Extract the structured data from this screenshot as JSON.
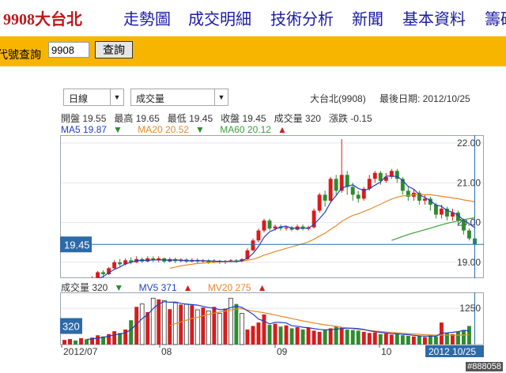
{
  "nav": {
    "stock": "9908大台北",
    "items": [
      "走勢圖",
      "成交明細",
      "技術分析",
      "新聞",
      "基本資料",
      "籌碼"
    ]
  },
  "search": {
    "label": "代號查詢",
    "value": "9908",
    "button": "查詢"
  },
  "controls": {
    "period_select": "日線",
    "indicator_select": "成交量"
  },
  "header": {
    "stock_name": "大台北(9908)",
    "last_date_label": "最後日期: 2012/10/25"
  },
  "quote": {
    "open": "開盤 19.55",
    "high": "最高 19.65",
    "low": "最低 19.45",
    "close": "收盤 19.45",
    "volume": "成交量 320",
    "change": "漲跌 -0.15"
  },
  "ma": {
    "ma5": "MA5 19.87",
    "ma20": "MA20 20.52",
    "ma60": "MA60 20.12"
  },
  "vol_ma": {
    "vol": "成交量 320",
    "mv5": "MV5 371",
    "mv20": "MV20 275"
  },
  "colors": {
    "up": "#d71c1c",
    "down": "#2e8b2e",
    "ma5": "#1f3fbf",
    "ma20": "#e8892a",
    "ma60": "#3aa03a",
    "nav_link": "#1a1aa6",
    "accent": "#f7b500"
  },
  "chart_data": {
    "type": "candlestick",
    "price_axis_ticks": [
      "22.00",
      "21.00",
      "20.00",
      "19.00"
    ],
    "price_ylim": [
      18.6,
      22.2
    ],
    "current_price_label": "19.45",
    "volume_axis_ticks": [
      "1250"
    ],
    "current_volume_label": "320",
    "x_ticks": [
      "2012/07",
      "08",
      "09",
      "10"
    ],
    "last_date_label": "2012 10/25",
    "candles": [
      [
        18.2,
        18.4,
        18.18,
        18.42
      ],
      [
        18.4,
        18.45,
        18.35,
        18.5
      ],
      [
        18.42,
        18.38,
        18.32,
        18.48
      ],
      [
        18.38,
        18.55,
        18.35,
        18.58
      ],
      [
        18.55,
        18.52,
        18.45,
        18.6
      ],
      [
        18.52,
        18.6,
        18.48,
        18.65
      ],
      [
        18.6,
        18.75,
        18.58,
        18.78
      ],
      [
        18.75,
        18.7,
        18.62,
        18.8
      ],
      [
        18.7,
        18.85,
        18.68,
        18.88
      ],
      [
        18.85,
        19.0,
        18.82,
        19.05
      ],
      [
        19.0,
        18.95,
        18.9,
        19.08
      ],
      [
        18.95,
        19.05,
        18.92,
        19.1
      ],
      [
        19.05,
        19.0,
        18.95,
        19.12
      ],
      [
        19.0,
        19.08,
        18.98,
        19.15
      ],
      [
        19.08,
        19.02,
        18.98,
        19.12
      ],
      [
        19.02,
        19.1,
        19.0,
        19.15
      ],
      [
        19.1,
        19.05,
        19.0,
        19.15
      ],
      [
        19.05,
        19.1,
        19.0,
        19.15
      ],
      [
        19.1,
        19.02,
        18.98,
        19.12
      ],
      [
        19.02,
        19.08,
        19.0,
        19.12
      ],
      [
        19.08,
        19.03,
        18.98,
        19.12
      ],
      [
        19.03,
        19.07,
        19.0,
        19.1
      ],
      [
        19.07,
        19.02,
        18.98,
        19.1
      ],
      [
        19.02,
        19.06,
        19.0,
        19.1
      ],
      [
        19.06,
        19.02,
        18.98,
        19.1
      ],
      [
        19.02,
        19.05,
        18.98,
        19.08
      ],
      [
        19.05,
        19.0,
        18.96,
        19.08
      ],
      [
        19.0,
        19.04,
        18.98,
        19.08
      ],
      [
        19.04,
        19.0,
        18.96,
        19.06
      ],
      [
        19.0,
        19.03,
        18.96,
        19.06
      ],
      [
        19.03,
        19.05,
        19.0,
        19.08
      ],
      [
        19.05,
        19.02,
        18.98,
        19.08
      ],
      [
        19.02,
        19.08,
        19.0,
        19.1
      ],
      [
        19.08,
        19.3,
        19.05,
        19.35
      ],
      [
        19.3,
        19.55,
        19.28,
        19.6
      ],
      [
        19.55,
        19.8,
        19.5,
        19.85
      ],
      [
        19.8,
        20.05,
        19.75,
        20.1
      ],
      [
        20.05,
        19.85,
        19.8,
        20.1
      ],
      [
        19.85,
        19.9,
        19.8,
        19.95
      ],
      [
        19.9,
        19.85,
        19.8,
        19.95
      ],
      [
        19.85,
        19.88,
        19.8,
        19.92
      ],
      [
        19.88,
        19.82,
        19.78,
        19.92
      ],
      [
        19.82,
        19.9,
        19.8,
        19.95
      ],
      [
        19.9,
        19.84,
        19.8,
        19.95
      ],
      [
        19.84,
        19.88,
        19.8,
        19.92
      ],
      [
        19.88,
        20.3,
        19.85,
        20.35
      ],
      [
        20.3,
        20.7,
        20.25,
        20.75
      ],
      [
        20.7,
        20.55,
        20.4,
        20.8
      ],
      [
        20.55,
        21.1,
        20.5,
        21.15
      ],
      [
        21.1,
        20.8,
        20.7,
        21.2
      ],
      [
        20.8,
        21.2,
        20.75,
        22.1
      ],
      [
        21.2,
        20.9,
        20.7,
        21.3
      ],
      [
        20.9,
        20.7,
        20.55,
        21.0
      ],
      [
        20.7,
        20.6,
        20.5,
        20.8
      ],
      [
        20.6,
        20.85,
        20.55,
        20.9
      ],
      [
        20.85,
        21.1,
        20.8,
        21.2
      ],
      [
        21.1,
        21.25,
        21.0,
        21.3
      ],
      [
        21.25,
        21.05,
        20.95,
        21.3
      ],
      [
        21.05,
        21.15,
        21.0,
        21.25
      ],
      [
        21.15,
        21.3,
        21.1,
        21.35
      ],
      [
        21.3,
        21.1,
        21.0,
        21.35
      ],
      [
        21.1,
        20.8,
        20.7,
        21.15
      ],
      [
        20.8,
        20.65,
        20.55,
        20.9
      ],
      [
        20.65,
        20.75,
        20.55,
        20.85
      ],
      [
        20.75,
        20.55,
        20.45,
        20.8
      ],
      [
        20.55,
        20.6,
        20.45,
        20.7
      ],
      [
        20.6,
        20.45,
        20.3,
        20.65
      ],
      [
        20.45,
        20.2,
        20.1,
        20.5
      ],
      [
        20.2,
        20.35,
        20.1,
        20.45
      ],
      [
        20.35,
        20.15,
        20.05,
        20.4
      ],
      [
        20.15,
        20.25,
        20.05,
        20.35
      ],
      [
        20.25,
        20.05,
        19.95,
        20.3
      ],
      [
        20.05,
        19.8,
        19.7,
        20.1
      ],
      [
        19.8,
        19.6,
        19.55,
        19.85
      ],
      [
        19.6,
        19.45,
        19.45,
        19.65
      ]
    ],
    "volumes": [
      80,
      95,
      70,
      110,
      90,
      120,
      160,
      140,
      180,
      230,
      200,
      260,
      420,
      650,
      700,
      560,
      800,
      780,
      760,
      610,
      720,
      690,
      700,
      680,
      600,
      640,
      580,
      650,
      540,
      620,
      800,
      700,
      540,
      260,
      320,
      380,
      520,
      340,
      360,
      310,
      330,
      280,
      300,
      260,
      290,
      240,
      220,
      260,
      280,
      320,
      300,
      260,
      250,
      240,
      220,
      200,
      210,
      180,
      190,
      170,
      180,
      160,
      150,
      140,
      150,
      130,
      160,
      140,
      380,
      200,
      180,
      220,
      250,
      320
    ],
    "ma5": [
      null,
      null,
      null,
      null,
      18.44,
      18.5,
      18.58,
      18.64,
      18.74,
      18.82,
      18.88,
      18.96,
      19.0,
      19.04,
      19.05,
      19.05,
      19.06,
      19.06,
      19.06,
      19.05,
      19.06,
      19.05,
      19.04,
      19.04,
      19.04,
      19.04,
      19.03,
      19.03,
      19.02,
      19.02,
      19.02,
      19.02,
      19.04,
      19.1,
      19.22,
      19.4,
      19.63,
      19.77,
      19.83,
      19.89,
      19.91,
      19.86,
      19.86,
      19.86,
      19.86,
      19.95,
      20.1,
      20.26,
      20.51,
      20.68,
      20.87,
      20.91,
      20.95,
      20.86,
      20.81,
      20.85,
      20.94,
      21.02,
      21.17,
      21.17,
      21.16,
      21.06,
      20.91,
      20.84,
      20.7,
      20.63,
      20.55,
      20.44,
      20.41,
      20.3,
      20.26,
      20.18,
      20.06,
      19.97,
      19.87
    ],
    "ma20": [
      null,
      null,
      null,
      null,
      null,
      null,
      null,
      null,
      null,
      null,
      null,
      null,
      null,
      null,
      null,
      null,
      null,
      null,
      null,
      18.85,
      18.88,
      18.91,
      18.93,
      18.95,
      18.97,
      18.98,
      18.99,
      19.0,
      19.01,
      19.01,
      19.02,
      19.02,
      19.03,
      19.05,
      19.08,
      19.12,
      19.18,
      19.22,
      19.27,
      19.31,
      19.35,
      19.39,
      19.43,
      19.47,
      19.51,
      19.58,
      19.66,
      19.73,
      19.83,
      19.92,
      20.03,
      20.11,
      20.18,
      20.22,
      20.28,
      20.33,
      20.4,
      20.46,
      20.53,
      20.59,
      20.64,
      20.67,
      20.68,
      20.7,
      20.71,
      20.7,
      20.7,
      20.68,
      20.66,
      20.64,
      20.62,
      20.6,
      20.57,
      20.55,
      20.52
    ],
    "ma60": [
      null,
      null,
      null,
      null,
      null,
      null,
      null,
      null,
      null,
      null,
      null,
      null,
      null,
      null,
      null,
      null,
      null,
      null,
      null,
      null,
      null,
      null,
      null,
      null,
      null,
      null,
      null,
      null,
      null,
      null,
      null,
      null,
      null,
      null,
      null,
      null,
      null,
      null,
      null,
      null,
      null,
      null,
      null,
      null,
      null,
      null,
      null,
      null,
      null,
      null,
      null,
      null,
      null,
      null,
      null,
      null,
      null,
      null,
      null,
      19.55,
      19.6,
      19.65,
      19.7,
      19.74,
      19.78,
      19.82,
      19.86,
      19.9,
      19.94,
      19.98,
      20.01,
      20.04,
      20.07,
      20.1,
      20.12
    ],
    "mv5": [
      null,
      null,
      null,
      null,
      89,
      97,
      110,
      124,
      142,
      166,
      182,
      202,
      258,
      352,
      446,
      514,
      622,
      698,
      740,
      730,
      734,
      712,
      696,
      690,
      680,
      658,
      638,
      630,
      602,
      606,
      638,
      662,
      642,
      584,
      524,
      440,
      404,
      356,
      384,
      382,
      372,
      324,
      316,
      298,
      292,
      274,
      262,
      252,
      258,
      264,
      276,
      284,
      282,
      274,
      262,
      236,
      224,
      210,
      200,
      190,
      186,
      176,
      170,
      160,
      150,
      146,
      146,
      144,
      196,
      202,
      212,
      224,
      246,
      234
    ],
    "mv20": [
      null,
      null,
      null,
      null,
      null,
      null,
      null,
      null,
      null,
      null,
      null,
      null,
      null,
      null,
      null,
      null,
      null,
      null,
      null,
      328,
      360,
      390,
      420,
      448,
      472,
      498,
      519,
      542,
      560,
      579,
      599,
      613,
      618,
      596,
      577,
      563,
      550,
      530,
      510,
      488,
      470,
      448,
      428,
      408,
      390,
      371,
      356,
      340,
      329,
      313,
      298,
      286,
      274,
      262,
      253,
      244,
      234,
      225,
      217,
      209,
      203,
      196,
      189,
      183,
      177,
      171,
      167,
      162,
      165,
      163,
      161,
      162,
      164,
      168
    ]
  },
  "watermark": "#888058"
}
